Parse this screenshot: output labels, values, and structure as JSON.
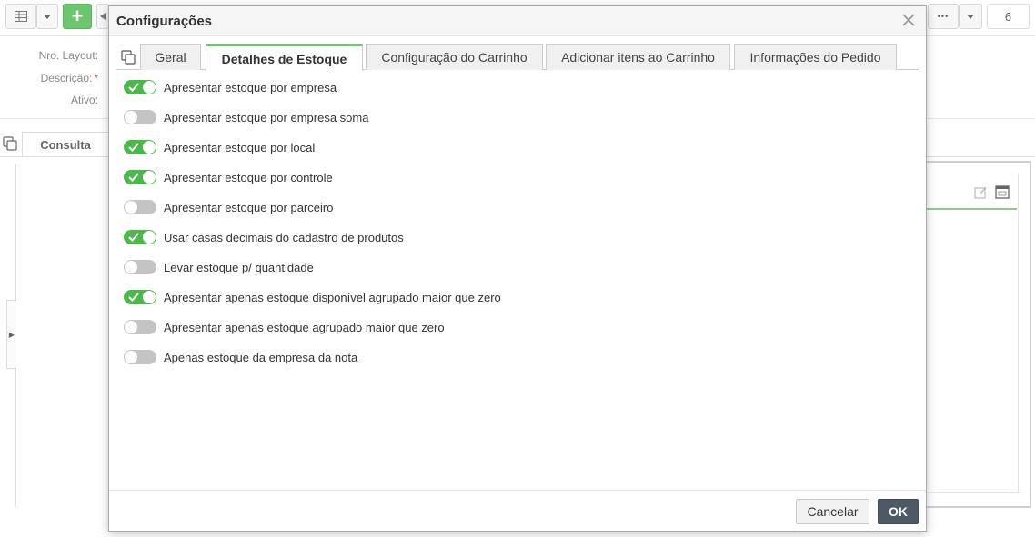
{
  "background": {
    "toolbar": {
      "add_label": "+",
      "more_label": "•••",
      "count": "6"
    },
    "fields": {
      "layout_label": "Nro. Layout:",
      "description_label": "Descrição:",
      "required_mark": "*",
      "active_label": "Ativo:"
    },
    "tab_consulta": "Consulta"
  },
  "modal": {
    "title": "Configurações",
    "tabs": [
      {
        "label": "Geral",
        "active": false
      },
      {
        "label": "Detalhes de Estoque",
        "active": true
      },
      {
        "label": "Configuração do Carrinho",
        "active": false
      },
      {
        "label": "Adicionar itens ao Carrinho",
        "active": false
      },
      {
        "label": "Informações do Pedido",
        "active": false
      }
    ],
    "options": [
      {
        "label": "Apresentar estoque por empresa",
        "on": true
      },
      {
        "label": "Apresentar estoque por empresa soma",
        "on": false
      },
      {
        "label": "Apresentar estoque por local",
        "on": true
      },
      {
        "label": "Apresentar estoque por controle",
        "on": true
      },
      {
        "label": "Apresentar estoque por parceiro",
        "on": false
      },
      {
        "label": "Usar casas decimais do cadastro de produtos",
        "on": true
      },
      {
        "label": "Levar estoque p/ quantidade",
        "on": false
      },
      {
        "label": "Apresentar apenas estoque disponível agrupado maior que zero",
        "on": true
      },
      {
        "label": "Apresentar apenas estoque agrupado maior que zero",
        "on": false
      },
      {
        "label": "Apenas estoque da empresa da nota",
        "on": false
      }
    ],
    "footer": {
      "cancel_label": "Cancelar",
      "ok_label": "OK"
    }
  },
  "colors": {
    "toggle_on": "#4cb84c",
    "toggle_off": "#c4c4c4",
    "active_tab_accent": "#6cc66c",
    "ok_button": "#4e5965"
  }
}
